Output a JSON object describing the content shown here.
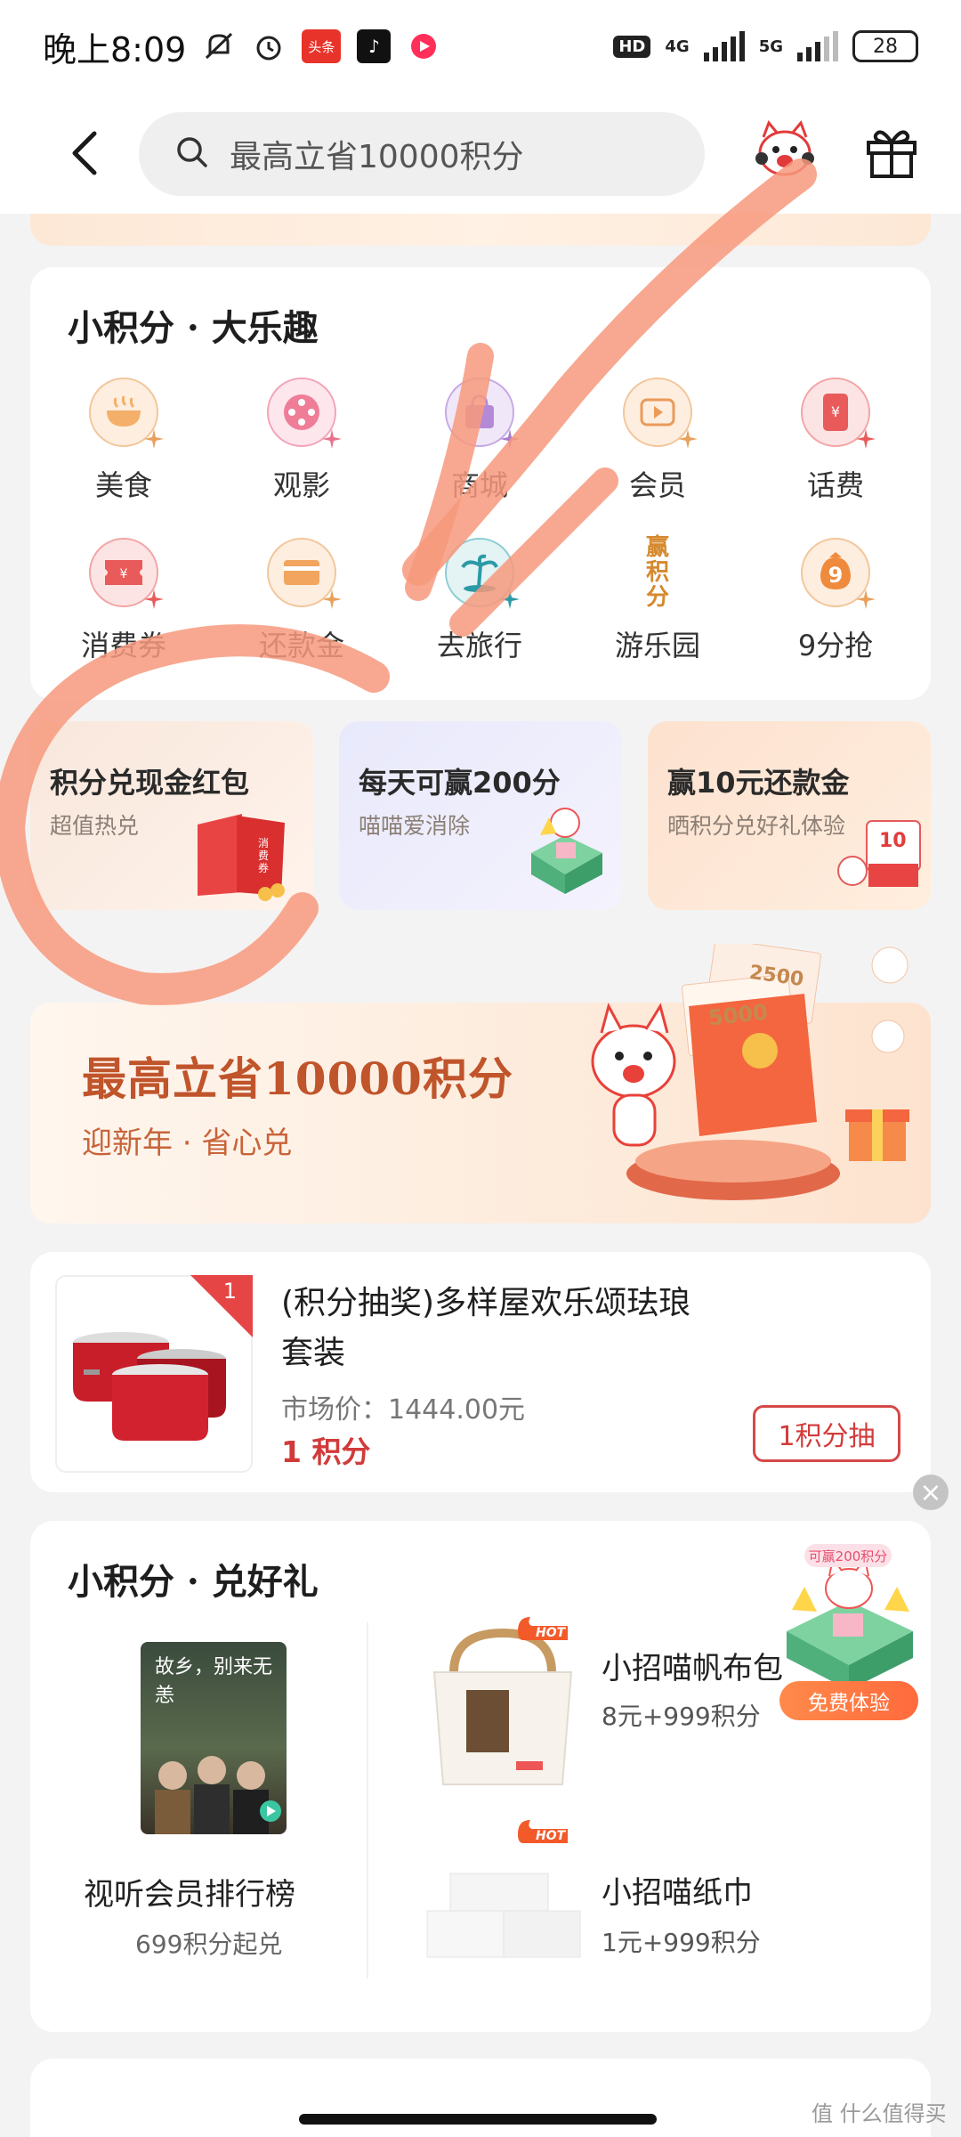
{
  "status_bar": {
    "time": "晚上8:09",
    "news_badge": "头条",
    "net1": "4G",
    "net2": "5G",
    "hd": "HD",
    "battery": "28"
  },
  "header": {
    "search_placeholder": "最高立省10000积分",
    "icons": [
      "back-icon",
      "search-icon",
      "mascot-icon",
      "gift-icon"
    ]
  },
  "section_fun": {
    "title": "小积分 · 大乐趣",
    "items": [
      {
        "label": "美食",
        "icon": "food-icon"
      },
      {
        "label": "观影",
        "icon": "film-icon"
      },
      {
        "label": "商城",
        "icon": "shop-icon"
      },
      {
        "label": "会员",
        "icon": "membership-icon"
      },
      {
        "label": "话费",
        "icon": "phone-bill-icon"
      },
      {
        "label": "消费券",
        "icon": "coupon-icon"
      },
      {
        "label": "还款金",
        "icon": "repay-card-icon"
      },
      {
        "label": "去旅行",
        "icon": "travel-icon"
      },
      {
        "label": "游乐园",
        "icon": "amusement-icon",
        "glyph": "赢积分"
      },
      {
        "label": "9分抢",
        "icon": "nine-points-icon",
        "glyph": "9"
      }
    ]
  },
  "promos": [
    {
      "title": "积分兑现金红包",
      "subtitle": "超值热兑",
      "badge": "消费券"
    },
    {
      "title": "每天可赢200分",
      "subtitle": "喵喵爱消除"
    },
    {
      "title": "赢10元还款金",
      "subtitle": "晒积分兑好礼体验",
      "badge": "10"
    }
  ],
  "banner": {
    "title": "最高立省10000积分",
    "subtitle": "迎新年 · 省心兑",
    "amounts": [
      "2500",
      "5000"
    ]
  },
  "product": {
    "rank": "1",
    "title": "(积分抽奖)多样屋欢乐颂珐琅套装",
    "market_price": "市场价：1444.00元",
    "points": "1 积分",
    "button": "1积分抽"
  },
  "section_gift": {
    "title": "小积分 · 兑好礼",
    "vip": {
      "label": "视听会员排行榜",
      "sub": "699积分起兑",
      "poster_text": "故乡，别来无恙"
    },
    "gifts": [
      {
        "name": "小招喵帆布包",
        "price": "8元+999积分",
        "tag": "HOT"
      },
      {
        "name": "小招喵纸巾",
        "price": "1元+999积分",
        "tag": "HOT"
      }
    ]
  },
  "float_ad": {
    "tag": "可赢200积分",
    "button": "免费体验"
  },
  "watermark": "值 什么值得买",
  "colors": {
    "accent_red": "#d23a3a",
    "banner_orange": "#c0542b",
    "overlay_stroke": "#f7997d"
  }
}
